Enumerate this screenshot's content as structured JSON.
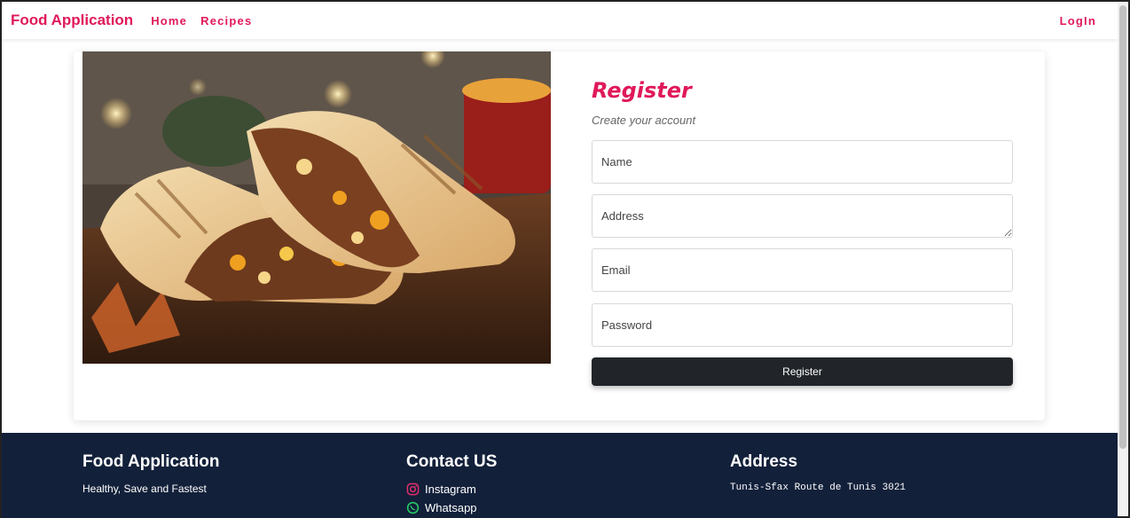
{
  "navbar": {
    "brand": "Food Application",
    "links": [
      "Home",
      "Recipes"
    ],
    "login": "LogIn"
  },
  "hero_image": {
    "alt": "Grilled burritos with ground beef, cheese and peppers"
  },
  "form": {
    "title": "Register",
    "subtitle": "Create your account",
    "name_placeholder": "Name",
    "address_placeholder": "Address",
    "email_placeholder": "Email",
    "password_placeholder": "Password",
    "submit_label": "Register"
  },
  "footer": {
    "brand": {
      "title": "Food Application",
      "tagline": "Healthy, Save and Fastest"
    },
    "contact": {
      "title": "Contact US",
      "links": [
        {
          "label": "Instagram",
          "icon": "instagram-icon",
          "color": "#e1306c"
        },
        {
          "label": "Whatsapp",
          "icon": "whatsapp-icon",
          "color": "#25d366"
        }
      ]
    },
    "address": {
      "title": "Address",
      "text": "Tunis-Sfax Route de Tunis 3021"
    }
  },
  "colors": {
    "accent": "#e0195a",
    "footer_bg": "#12203a",
    "button_bg": "#212529"
  }
}
